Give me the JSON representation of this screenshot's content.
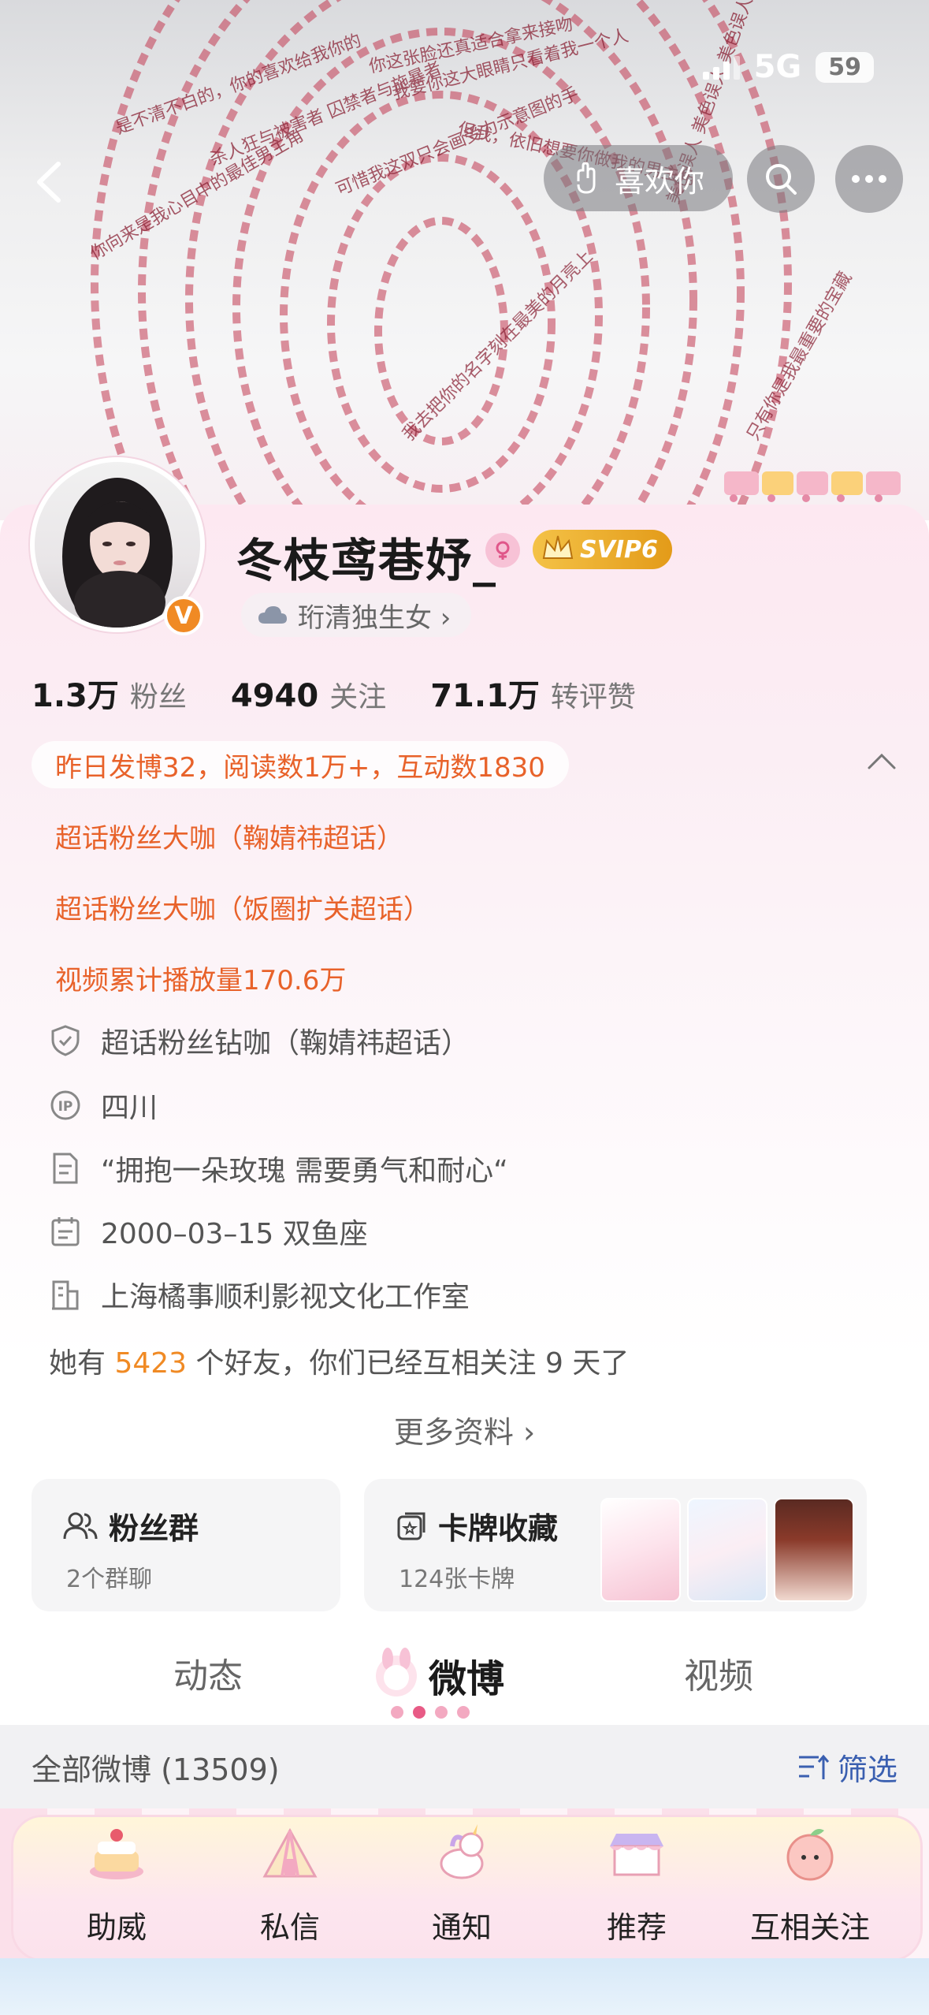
{
  "status_bar": {
    "network": "5G",
    "battery": "59"
  },
  "header": {
    "like_button_label": "喜欢你",
    "fingerprint_text": [
      "你这张脸还真适合拿来接吻",
      "我要你这大眼睛只看着我一个人",
      "是不清不白的，你的喜欢给我你的",
      "可惜我这双只会画受力示意图的手",
      "你向来是我心目中的最佳男主角",
      "杀人狂与被害者 囚禁者与施暴者",
      "但我，依旧想要你做我的男主角",
      "我去把你的名字刻在最美的月亮上",
      "美色误人 美色误人 美色误人",
      "只有你是我最重要的宝藏"
    ]
  },
  "profile": {
    "nickname": "冬枝鸢巷妤_",
    "verified_badge": "V",
    "svip_label": "SVIP6",
    "tag_label": "珩清独生女 ›",
    "stats": [
      {
        "num": "1.3万",
        "label": "粉丝"
      },
      {
        "num": "4940",
        "label": "关注"
      },
      {
        "num": "71.1万",
        "label": "转评赞"
      }
    ],
    "achievement": "昨日发博32，阅读数1万+，互动数1830",
    "highlights": [
      "超话粉丝大咖（鞠婧祎超话）",
      "超话粉丝大咖（饭圈扩关超话）",
      "视频累计播放量170.6万"
    ],
    "info": [
      {
        "icon": "shield-check-icon",
        "text": "超话粉丝钻咖（鞠婧祎超话）"
      },
      {
        "icon": "ip-icon",
        "text": "四川"
      },
      {
        "icon": "document-icon",
        "text": "“拥抱一朵玫瑰 需要勇气和耐心“"
      },
      {
        "icon": "calendar-icon",
        "text": "2000–03–15 双鱼座"
      },
      {
        "icon": "building-icon",
        "text": "上海橘事顺利影视文化工作室"
      }
    ],
    "friends": {
      "prefix": "她有 ",
      "count": "5423",
      "suffix": " 个好友，你们已经互相关注 9 天了"
    },
    "more_label": "更多资料 ›"
  },
  "boxes": {
    "fan_group": {
      "title": "粉丝群",
      "sub": "2个群聊"
    },
    "cards": {
      "title": "卡牌收藏",
      "sub": "124张卡牌"
    }
  },
  "tabs": [
    {
      "label": "动态",
      "active": false
    },
    {
      "label": "微博",
      "active": true
    },
    {
      "label": "视频",
      "active": false
    }
  ],
  "filter_bar": {
    "label": "全部微博 (13509)",
    "filter_label": "筛选"
  },
  "bottom_nav": [
    {
      "label": "助威"
    },
    {
      "label": "私信"
    },
    {
      "label": "通知"
    },
    {
      "label": "推荐"
    },
    {
      "label": "互相关注"
    }
  ],
  "colors": {
    "accent_orange": "#e8622a",
    "link_blue": "#3a5fb0",
    "vip_gold": "#f4c247"
  }
}
